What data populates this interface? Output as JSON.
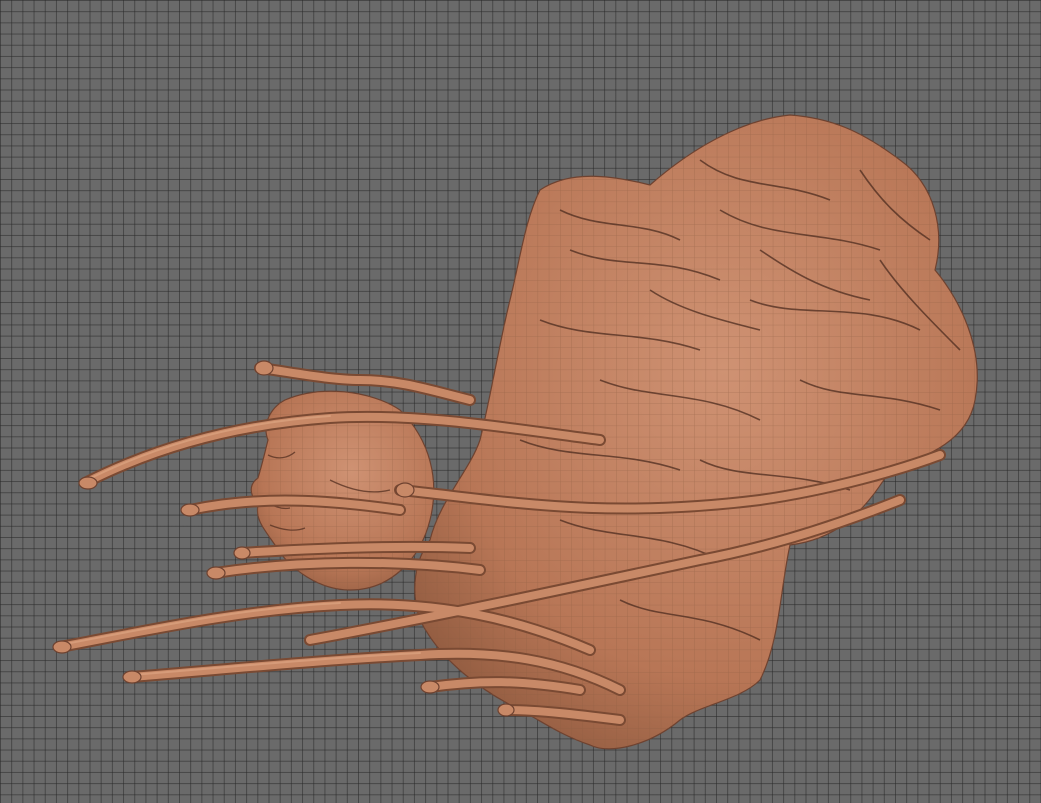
{
  "viewport": {
    "background": "#6a6a6a",
    "grid_color": "#3a3a3a"
  },
  "model": {
    "icon": "3d-sculpt-mesh",
    "clay_color": "#c0805e",
    "clay_highlight": "#d9a083",
    "clay_shadow": "#7a4a33",
    "wireframe": true
  }
}
